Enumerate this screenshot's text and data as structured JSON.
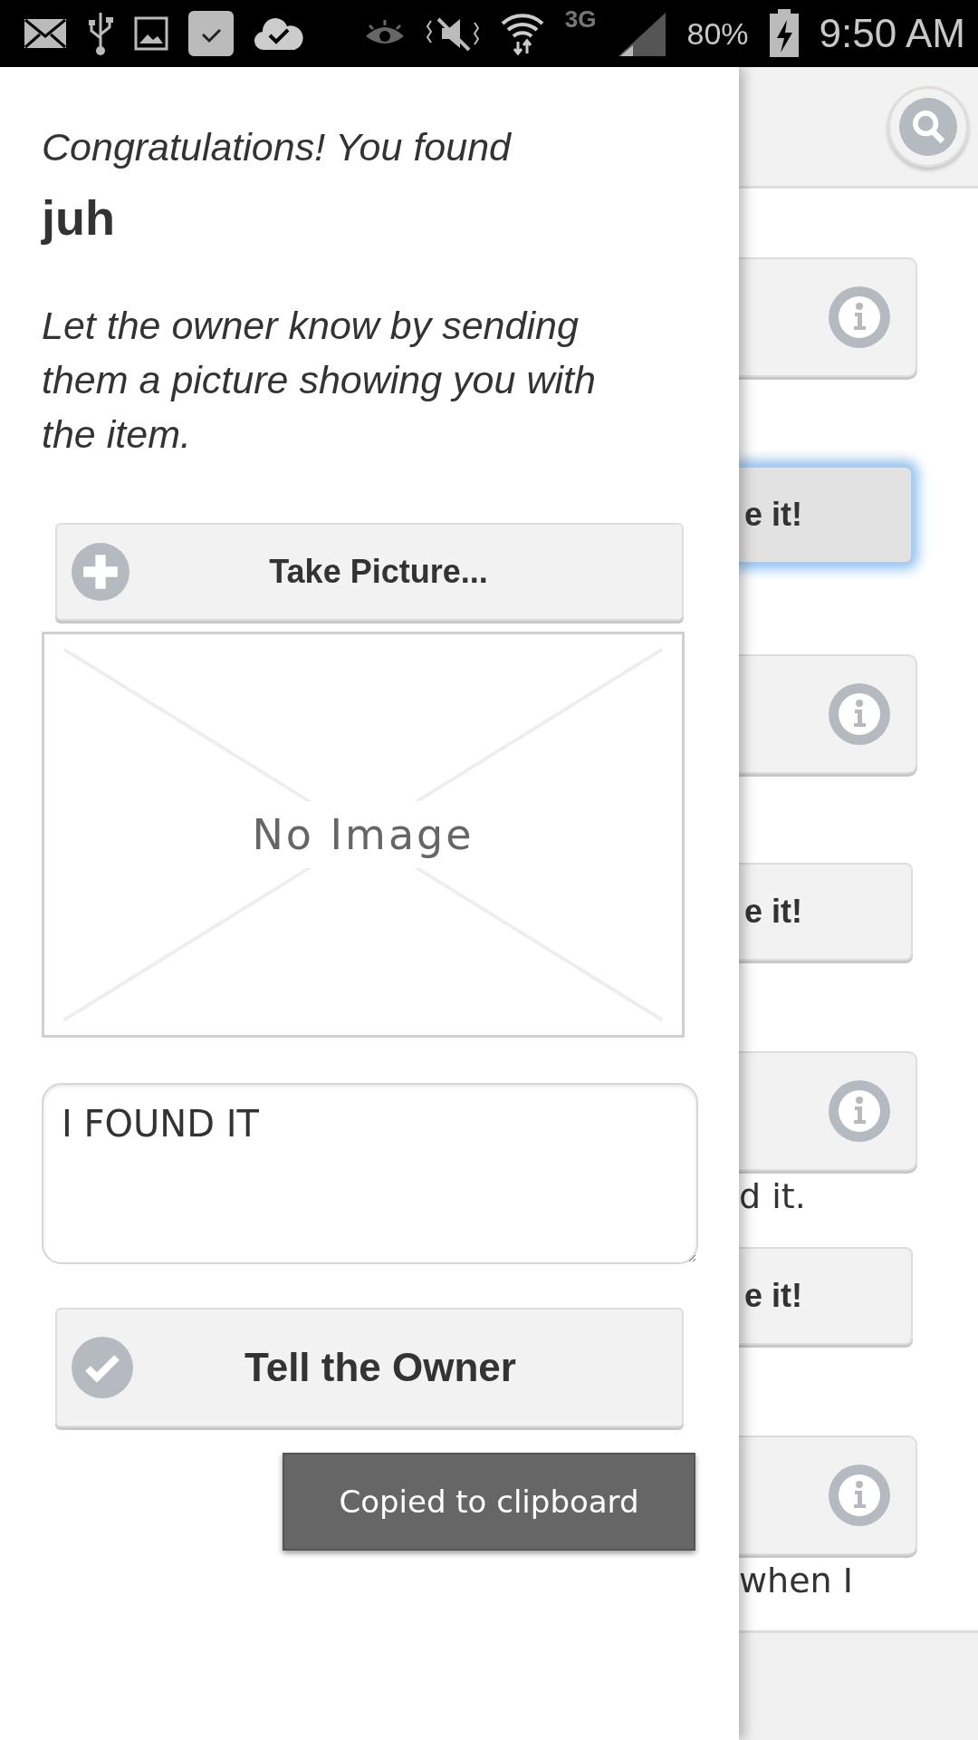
{
  "status_bar": {
    "network": "3G",
    "battery": "80%",
    "time": "9:50 AM"
  },
  "drawer": {
    "title": "Congratulations! You found",
    "item_name": "juh",
    "instructions": "Let the owner know by sending them a picture showing you with the item.",
    "take_picture_button": "Take Picture...",
    "image_placeholder": "No Image",
    "message_field": {
      "value": "I FOUND IT"
    },
    "submit_button": "Tell the Owner"
  },
  "toast": "Copied to clipboard",
  "background_page": {
    "items": [
      {
        "kind": "info_button"
      },
      {
        "kind": "action_button",
        "label": "e it!",
        "focused": true
      },
      {
        "kind": "info_button"
      },
      {
        "kind": "action_button",
        "label": "e it!",
        "focused": false
      },
      {
        "kind": "info_button"
      },
      {
        "kind": "text",
        "text": "d it."
      },
      {
        "kind": "action_button",
        "label": "e it!",
        "focused": false
      },
      {
        "kind": "info_button"
      },
      {
        "kind": "text",
        "text": "when I"
      }
    ]
  }
}
